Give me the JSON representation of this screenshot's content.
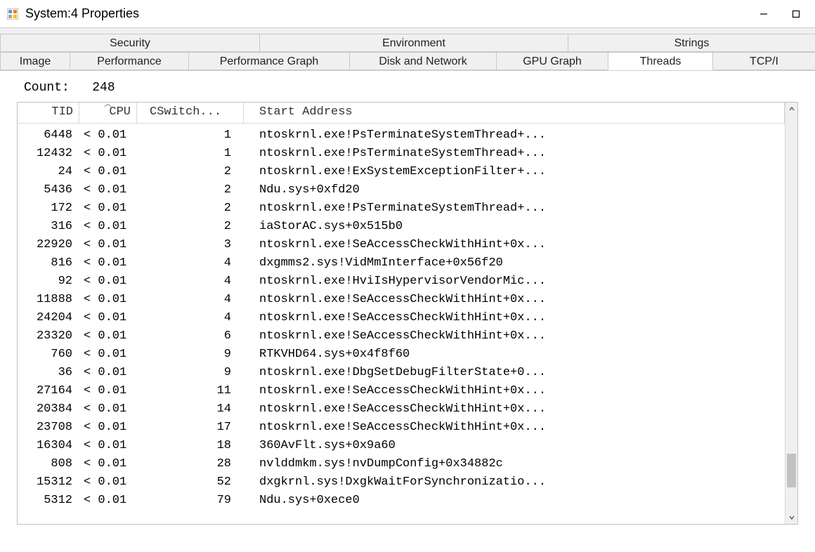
{
  "window": {
    "title": "System:4 Properties"
  },
  "tabs": {
    "row1": [
      {
        "label": "Security",
        "active": false
      },
      {
        "label": "Environment",
        "active": false
      },
      {
        "label": "Strings",
        "active": false
      }
    ],
    "row2": [
      {
        "label": "Image",
        "active": false
      },
      {
        "label": "Performance",
        "active": false
      },
      {
        "label": "Performance Graph",
        "active": false
      },
      {
        "label": "Disk and Network",
        "active": false
      },
      {
        "label": "GPU Graph",
        "active": false
      },
      {
        "label": "Threads",
        "active": true
      },
      {
        "label": "TCP/I",
        "active": false
      }
    ]
  },
  "threads": {
    "count_label": "Count:",
    "count_value": "248",
    "columns": {
      "tid": "TID",
      "cpu": "CPU",
      "cswitch": "CSwitch...",
      "start_addr": "Start Address"
    },
    "sort_column": "cpu",
    "sort_dir": "asc",
    "rows": [
      {
        "tid": "6448",
        "cpu": "< 0.01",
        "csw": "1",
        "addr": "ntoskrnl.exe!PsTerminateSystemThread+..."
      },
      {
        "tid": "12432",
        "cpu": "< 0.01",
        "csw": "1",
        "addr": "ntoskrnl.exe!PsTerminateSystemThread+..."
      },
      {
        "tid": "24",
        "cpu": "< 0.01",
        "csw": "2",
        "addr": "ntoskrnl.exe!ExSystemExceptionFilter+..."
      },
      {
        "tid": "5436",
        "cpu": "< 0.01",
        "csw": "2",
        "addr": "Ndu.sys+0xfd20"
      },
      {
        "tid": "172",
        "cpu": "< 0.01",
        "csw": "2",
        "addr": "ntoskrnl.exe!PsTerminateSystemThread+..."
      },
      {
        "tid": "316",
        "cpu": "< 0.01",
        "csw": "2",
        "addr": "iaStorAC.sys+0x515b0"
      },
      {
        "tid": "22920",
        "cpu": "< 0.01",
        "csw": "3",
        "addr": "ntoskrnl.exe!SeAccessCheckWithHint+0x..."
      },
      {
        "tid": "816",
        "cpu": "< 0.01",
        "csw": "4",
        "addr": "dxgmms2.sys!VidMmInterface+0x56f20"
      },
      {
        "tid": "92",
        "cpu": "< 0.01",
        "csw": "4",
        "addr": "ntoskrnl.exe!HviIsHypervisorVendorMic..."
      },
      {
        "tid": "11888",
        "cpu": "< 0.01",
        "csw": "4",
        "addr": "ntoskrnl.exe!SeAccessCheckWithHint+0x..."
      },
      {
        "tid": "24204",
        "cpu": "< 0.01",
        "csw": "4",
        "addr": "ntoskrnl.exe!SeAccessCheckWithHint+0x..."
      },
      {
        "tid": "23320",
        "cpu": "< 0.01",
        "csw": "6",
        "addr": "ntoskrnl.exe!SeAccessCheckWithHint+0x..."
      },
      {
        "tid": "760",
        "cpu": "< 0.01",
        "csw": "9",
        "addr": "RTKVHD64.sys+0x4f8f60"
      },
      {
        "tid": "36",
        "cpu": "< 0.01",
        "csw": "9",
        "addr": "ntoskrnl.exe!DbgSetDebugFilterState+0..."
      },
      {
        "tid": "27164",
        "cpu": "< 0.01",
        "csw": "11",
        "addr": "ntoskrnl.exe!SeAccessCheckWithHint+0x..."
      },
      {
        "tid": "20384",
        "cpu": "< 0.01",
        "csw": "14",
        "addr": "ntoskrnl.exe!SeAccessCheckWithHint+0x..."
      },
      {
        "tid": "23708",
        "cpu": "< 0.01",
        "csw": "17",
        "addr": "ntoskrnl.exe!SeAccessCheckWithHint+0x..."
      },
      {
        "tid": "16304",
        "cpu": "< 0.01",
        "csw": "18",
        "addr": "360AvFlt.sys+0x9a60"
      },
      {
        "tid": "808",
        "cpu": "< 0.01",
        "csw": "28",
        "addr": "nvlddmkm.sys!nvDumpConfig+0x34882c"
      },
      {
        "tid": "15312",
        "cpu": "< 0.01",
        "csw": "52",
        "addr": "dxgkrnl.sys!DxgkWaitForSynchronizatio..."
      },
      {
        "tid": "5312",
        "cpu": "< 0.01",
        "csw": "79",
        "addr": "Ndu.sys+0xece0"
      }
    ]
  }
}
